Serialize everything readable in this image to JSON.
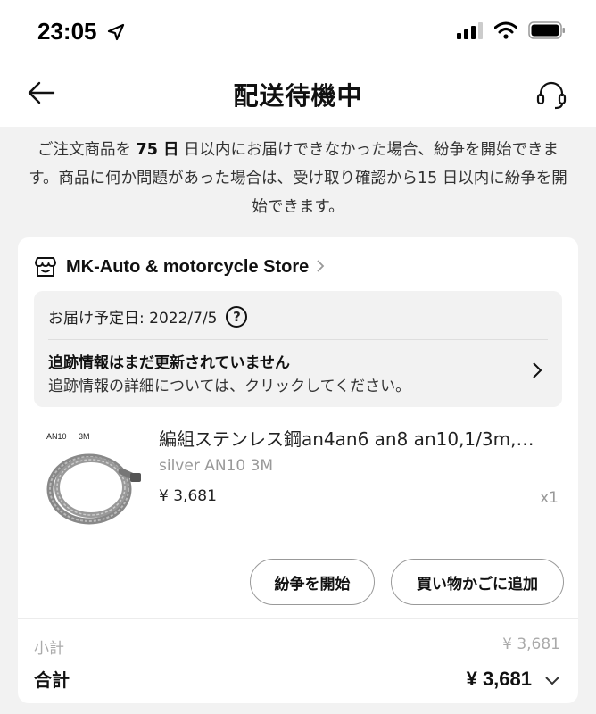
{
  "status_bar": {
    "time": "23:05",
    "icons": [
      "location-arrow-icon",
      "signal-icon",
      "wifi-icon",
      "battery-icon"
    ]
  },
  "header": {
    "title": "配送待機中",
    "back_icon": "back-arrow-icon",
    "support_icon": "headset-icon"
  },
  "notice": {
    "part1": "ご注文商品を ",
    "days_bold": "75 日",
    "part2": " 日以内にお届けできなかった場合、紛争を開始できます。商品に何か問題があった場合は、受け取り確認から15 日以内に紛争を開始できます。"
  },
  "order": {
    "store_name": "MK-Auto & motorcycle Store",
    "eta_label": "お届け予定日: 2022/7/5",
    "tracking_title": "追跡情報はまだ更新されていません",
    "tracking_sub": "追跡情報の詳細については、クリックしてください。",
    "product": {
      "image_label_1": "AN10",
      "image_label_2": "3M",
      "title": "編組ステンレス鋼an4an6 an8 an10,1/3m,…",
      "variant": "silver AN10 3M",
      "price": "¥ 3,681",
      "quantity": "x1"
    },
    "buttons": {
      "dispute": "紛争を開始",
      "add_to_cart": "買い物かごに追加"
    },
    "subtotal_label": "小計",
    "subtotal_value": "¥ 3,681",
    "total_label": "合計",
    "total_value": "¥ 3,681"
  }
}
